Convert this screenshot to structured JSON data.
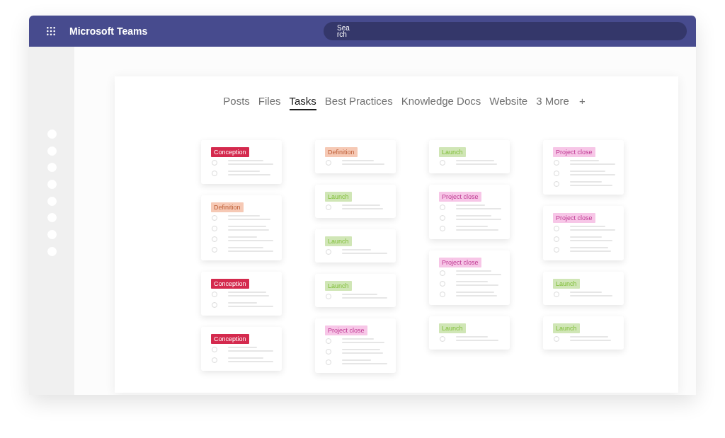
{
  "window": {
    "app_title": "Microsoft Teams",
    "search": {
      "placeholder": "Search"
    }
  },
  "tabs": [
    {
      "label": "Posts",
      "selected": false
    },
    {
      "label": "Files",
      "selected": false
    },
    {
      "label": "Tasks",
      "selected": true
    },
    {
      "label": "Best Practices",
      "selected": false
    },
    {
      "label": "Knowledge Docs",
      "selected": false
    },
    {
      "label": "Website",
      "selected": false
    }
  ],
  "more_tabs": "3 More",
  "add_tab": "+",
  "board": {
    "columns": [
      {
        "cards": [
          {
            "tag": {
              "label": "Conception",
              "kind": "solid",
              "color": "#d42a4e"
            },
            "items": [
              {
                "checked": false
              },
              {
                "checked": false
              }
            ]
          },
          {
            "tag": {
              "label": "Definition",
              "kind": "soft",
              "color": "#f6c9b5"
            },
            "items": [
              {
                "checked": false
              },
              {
                "checked": false
              },
              {
                "checked": false
              },
              {
                "checked": false
              }
            ]
          },
          {
            "tag": {
              "label": "Conception",
              "kind": "solid",
              "color": "#d42a4e"
            },
            "items": [
              {
                "checked": false
              },
              {
                "checked": false
              }
            ]
          },
          {
            "tag": {
              "label": "Conception",
              "kind": "solid",
              "color": "#d42a4e"
            },
            "items": [
              {
                "checked": false
              },
              {
                "checked": false
              }
            ]
          }
        ]
      },
      {
        "cards": [
          {
            "tag": {
              "label": "Definition",
              "kind": "soft",
              "color": "#f6c9b5"
            },
            "items": [
              {
                "checked": false
              }
            ]
          },
          {
            "tag": {
              "label": "Launch",
              "kind": "soft",
              "color": "#d0e6b6"
            },
            "items": [
              {
                "checked": false
              }
            ]
          },
          {
            "tag": {
              "label": "Launch",
              "kind": "soft",
              "color": "#d0e6b6"
            },
            "items": [
              {
                "checked": false
              }
            ]
          },
          {
            "tag": {
              "label": "Launch",
              "kind": "soft",
              "color": "#d0e6b6"
            },
            "items": [
              {
                "checked": false
              }
            ]
          },
          {
            "tag": {
              "label": "Project close",
              "kind": "soft",
              "color": "#f7c6e7"
            },
            "items": [
              {
                "checked": false
              },
              {
                "checked": false
              },
              {
                "checked": false
              }
            ]
          }
        ]
      },
      {
        "cards": [
          {
            "tag": {
              "label": "Launch",
              "kind": "soft",
              "color": "#d0e6b6"
            },
            "items": [
              {
                "checked": false
              }
            ]
          },
          {
            "tag": {
              "label": "Project close",
              "kind": "soft",
              "color": "#f7c6e7"
            },
            "items": [
              {
                "checked": false
              },
              {
                "checked": false
              },
              {
                "checked": false
              }
            ]
          },
          {
            "tag": {
              "label": "Project close",
              "kind": "soft",
              "color": "#f7c6e7"
            },
            "items": [
              {
                "checked": false
              },
              {
                "checked": false
              },
              {
                "checked": false
              }
            ]
          },
          {
            "tag": {
              "label": "Launch",
              "kind": "soft",
              "color": "#d0e6b6"
            },
            "items": [
              {
                "checked": false
              }
            ]
          }
        ]
      },
      {
        "cards": [
          {
            "tag": {
              "label": "Project close",
              "kind": "soft",
              "color": "#f7c6e7"
            },
            "items": [
              {
                "checked": false
              },
              {
                "checked": false
              },
              {
                "checked": false
              }
            ]
          },
          {
            "tag": {
              "label": "Project close",
              "kind": "soft",
              "color": "#f7c6e7"
            },
            "items": [
              {
                "checked": false
              },
              {
                "checked": false
              },
              {
                "checked": false
              }
            ]
          },
          {
            "tag": {
              "label": "Launch",
              "kind": "soft",
              "color": "#d0e6b6"
            },
            "items": [
              {
                "checked": false
              }
            ]
          },
          {
            "tag": {
              "label": "Launch",
              "kind": "soft",
              "color": "#d0e6b6"
            },
            "items": [
              {
                "checked": false
              }
            ]
          }
        ]
      }
    ]
  }
}
